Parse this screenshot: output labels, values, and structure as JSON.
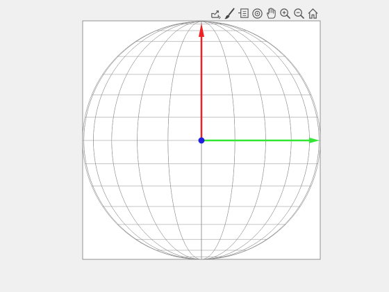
{
  "figure": {
    "background": "#f0f0f0"
  },
  "toolbar": {
    "icons": [
      "export-icon",
      "brush-icon",
      "data-tips-icon",
      "rotate-3d-icon",
      "pan-icon",
      "zoom-in-icon",
      "zoom-out-icon",
      "home-icon"
    ]
  },
  "sphere": {
    "wire_color": "#8c8c8c",
    "latitude_lines": 15,
    "longitude_lines": 11
  },
  "vectors": [
    {
      "name": "x-axis-vector",
      "color": "#33e633",
      "direction": "right"
    },
    {
      "name": "z-axis-vector",
      "color": "#ee2222",
      "direction": "up"
    }
  ],
  "origin": {
    "color": "#2222dd"
  },
  "box": {
    "edge_color": "#7a7a7a",
    "face_color": "#ffffff"
  }
}
